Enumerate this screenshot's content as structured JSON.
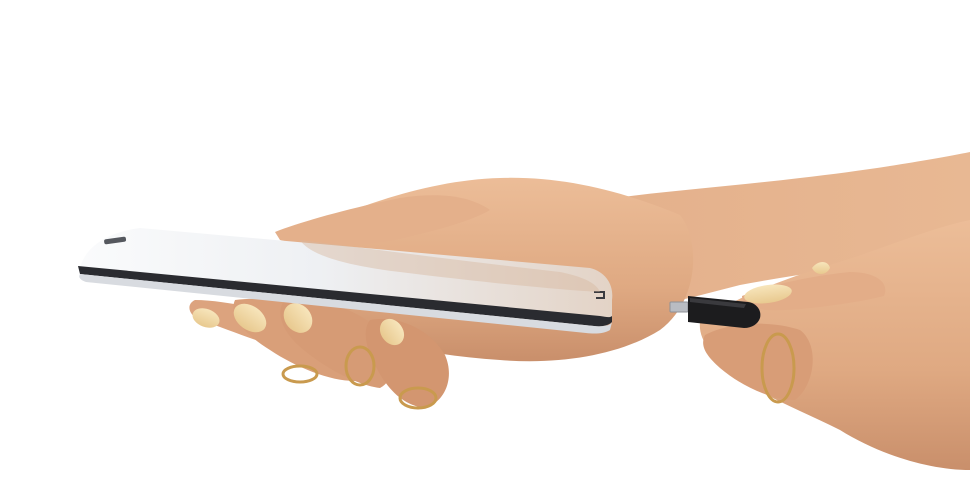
{
  "scene": {
    "subject": "hand-holding-phone-with-usb-cable",
    "background_color": "#ffffff",
    "skin_color": "#e0ad87",
    "skin_shadow_color": "#c98f6b",
    "nail_color": "#f2d9a6",
    "ring_color": "#c99a4e",
    "phone_body_color": "#f1f2f4",
    "phone_edge_color": "#2a2b30",
    "cable_color": "#1c1c1e",
    "connector_color": "#b9bcc2"
  }
}
